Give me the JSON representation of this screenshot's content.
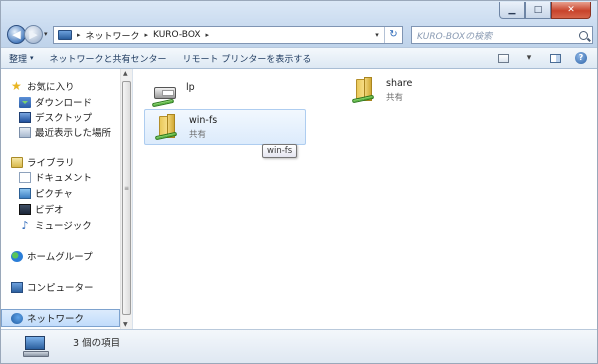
{
  "window": {
    "controls": {
      "minimize": "▁",
      "maximize": "□",
      "close": "✕"
    }
  },
  "nav": {
    "back": "◀",
    "forward": "▶",
    "dropdown": "▾"
  },
  "address": {
    "segments": [
      "ネットワーク",
      "KURO-BOX"
    ],
    "separator": "▸",
    "refresh": "↻",
    "dropdown": "▾"
  },
  "search": {
    "placeholder": "KURO-BOXの検索"
  },
  "commandbar": {
    "organize": "整理",
    "network_center": "ネットワークと共有センター",
    "remote_printers": "リモート プリンターを表示する",
    "dropdown": "▾",
    "help": "?"
  },
  "sidebar": {
    "favorites": {
      "label": "お気に入り",
      "items": [
        "ダウンロード",
        "デスクトップ",
        "最近表示した場所"
      ]
    },
    "libraries": {
      "label": "ライブラリ",
      "items": [
        "ドキュメント",
        "ピクチャ",
        "ビデオ",
        "ミュージック"
      ]
    },
    "homegroup": "ホームグループ",
    "computer": "コンピューター",
    "network": "ネットワーク"
  },
  "files": [
    {
      "name": "lp",
      "subtitle": ""
    },
    {
      "name": "share",
      "subtitle": "共有"
    },
    {
      "name": "win-fs",
      "subtitle": "共有"
    }
  ],
  "tooltip": "win-fs",
  "details": {
    "item_count": "3 個の項目"
  },
  "colors": {
    "accent": "#2b5f9e",
    "selection_bg": "#dcebfc",
    "folder": "#e9c95a",
    "share_pipe": "#3ea62a"
  }
}
